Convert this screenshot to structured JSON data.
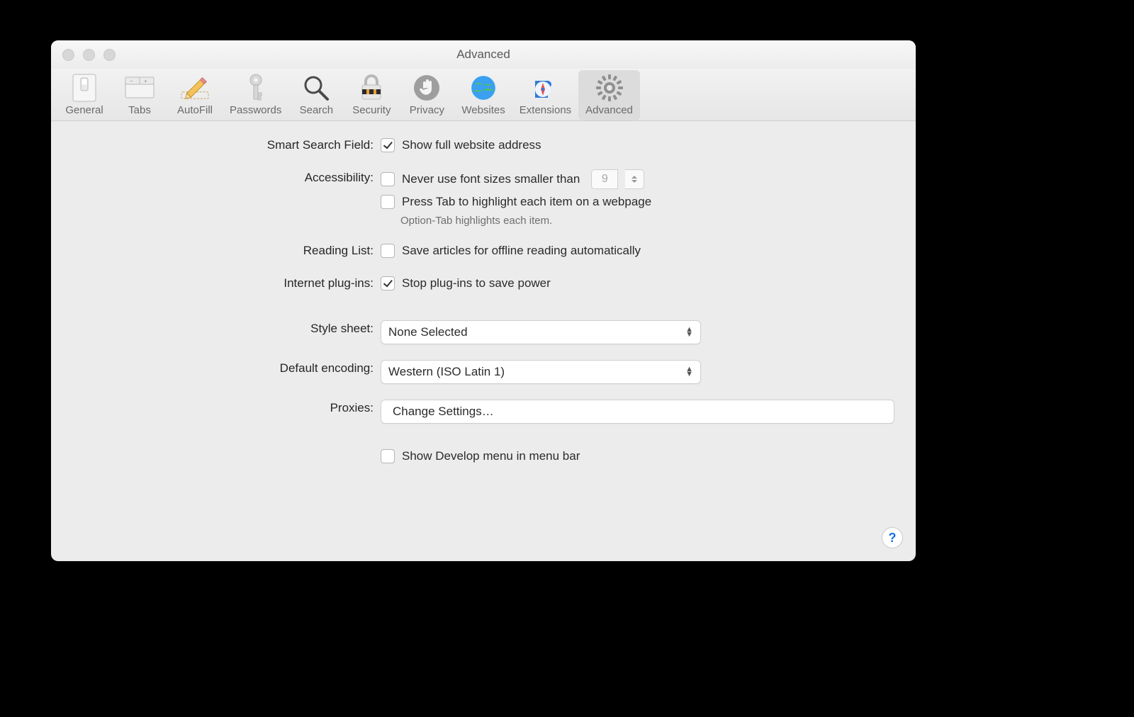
{
  "window": {
    "title": "Advanced"
  },
  "toolbar": {
    "items": [
      {
        "id": "general",
        "label": "General"
      },
      {
        "id": "tabs",
        "label": "Tabs"
      },
      {
        "id": "autofill",
        "label": "AutoFill"
      },
      {
        "id": "passwords",
        "label": "Passwords"
      },
      {
        "id": "search",
        "label": "Search"
      },
      {
        "id": "security",
        "label": "Security"
      },
      {
        "id": "privacy",
        "label": "Privacy"
      },
      {
        "id": "websites",
        "label": "Websites"
      },
      {
        "id": "extensions",
        "label": "Extensions"
      },
      {
        "id": "advanced",
        "label": "Advanced"
      }
    ],
    "selected": "advanced"
  },
  "labels": {
    "smart_search": "Smart Search Field:",
    "accessibility": "Accessibility:",
    "reading_list": "Reading List:",
    "plugins": "Internet plug-ins:",
    "style_sheet": "Style sheet:",
    "default_encoding": "Default encoding:",
    "proxies": "Proxies:"
  },
  "options": {
    "show_full_address": {
      "label": "Show full website address",
      "checked": true
    },
    "never_font_smaller": {
      "label": "Never use font sizes smaller than",
      "checked": false,
      "value": "9"
    },
    "press_tab": {
      "label": "Press Tab to highlight each item on a webpage",
      "checked": false
    },
    "press_tab_hint": "Option-Tab highlights each item.",
    "save_offline": {
      "label": "Save articles for offline reading automatically",
      "checked": false
    },
    "stop_plugins": {
      "label": "Stop plug-ins to save power",
      "checked": true
    },
    "style_sheet_value": "None Selected",
    "default_encoding_value": "Western (ISO Latin 1)",
    "proxies_button": "Change Settings…",
    "show_develop": {
      "label": "Show Develop menu in menu bar",
      "checked": false
    }
  },
  "help_tooltip": "?"
}
